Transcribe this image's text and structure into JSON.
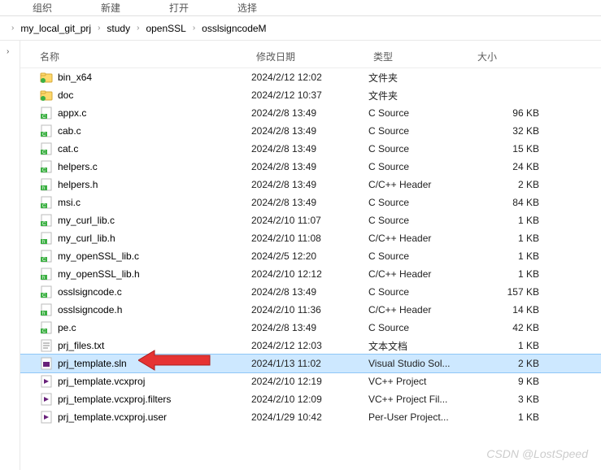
{
  "toolbar": {
    "org": "组织",
    "new": "新建",
    "open": "打开",
    "select": "选择"
  },
  "breadcrumb": [
    "",
    "my_local_git_prj",
    "study",
    "openSSL",
    "osslsigncodeM"
  ],
  "headers": {
    "name": "名称",
    "date": "修改日期",
    "type": "类型",
    "size": "大小"
  },
  "rows": [
    {
      "icon": "folder",
      "name": "bin_x64",
      "date": "2024/2/12 12:02",
      "type": "文件夹",
      "size": ""
    },
    {
      "icon": "folder",
      "name": "doc",
      "date": "2024/2/12 10:37",
      "type": "文件夹",
      "size": ""
    },
    {
      "icon": "c",
      "name": "appx.c",
      "date": "2024/2/8 13:49",
      "type": "C Source",
      "size": "96 KB"
    },
    {
      "icon": "c",
      "name": "cab.c",
      "date": "2024/2/8 13:49",
      "type": "C Source",
      "size": "32 KB"
    },
    {
      "icon": "c",
      "name": "cat.c",
      "date": "2024/2/8 13:49",
      "type": "C Source",
      "size": "15 KB"
    },
    {
      "icon": "c",
      "name": "helpers.c",
      "date": "2024/2/8 13:49",
      "type": "C Source",
      "size": "24 KB"
    },
    {
      "icon": "h",
      "name": "helpers.h",
      "date": "2024/2/8 13:49",
      "type": "C/C++ Header",
      "size": "2 KB"
    },
    {
      "icon": "c",
      "name": "msi.c",
      "date": "2024/2/8 13:49",
      "type": "C Source",
      "size": "84 KB"
    },
    {
      "icon": "c",
      "name": "my_curl_lib.c",
      "date": "2024/2/10 11:07",
      "type": "C Source",
      "size": "1 KB"
    },
    {
      "icon": "h",
      "name": "my_curl_lib.h",
      "date": "2024/2/10 11:08",
      "type": "C/C++ Header",
      "size": "1 KB"
    },
    {
      "icon": "c",
      "name": "my_openSSL_lib.c",
      "date": "2024/2/5 12:20",
      "type": "C Source",
      "size": "1 KB"
    },
    {
      "icon": "h",
      "name": "my_openSSL_lib.h",
      "date": "2024/2/10 12:12",
      "type": "C/C++ Header",
      "size": "1 KB"
    },
    {
      "icon": "c",
      "name": "osslsigncode.c",
      "date": "2024/2/8 13:49",
      "type": "C Source",
      "size": "157 KB"
    },
    {
      "icon": "h",
      "name": "osslsigncode.h",
      "date": "2024/2/10 11:36",
      "type": "C/C++ Header",
      "size": "14 KB"
    },
    {
      "icon": "c",
      "name": "pe.c",
      "date": "2024/2/8 13:49",
      "type": "C Source",
      "size": "42 KB"
    },
    {
      "icon": "txt",
      "name": "prj_files.txt",
      "date": "2024/2/12 12:03",
      "type": "文本文档",
      "size": "1 KB"
    },
    {
      "icon": "sln",
      "name": "prj_template.sln",
      "date": "2024/1/13 11:02",
      "type": "Visual Studio Sol...",
      "size": "2 KB",
      "selected": true
    },
    {
      "icon": "vcx",
      "name": "prj_template.vcxproj",
      "date": "2024/2/10 12:19",
      "type": "VC++ Project",
      "size": "9 KB"
    },
    {
      "icon": "vcx",
      "name": "prj_template.vcxproj.filters",
      "date": "2024/2/10 12:09",
      "type": "VC++ Project Fil...",
      "size": "3 KB"
    },
    {
      "icon": "vcx",
      "name": "prj_template.vcxproj.user",
      "date": "2024/1/29 10:42",
      "type": "Per-User Project...",
      "size": "1 KB"
    }
  ],
  "watermark": "CSDN @LostSpeed"
}
